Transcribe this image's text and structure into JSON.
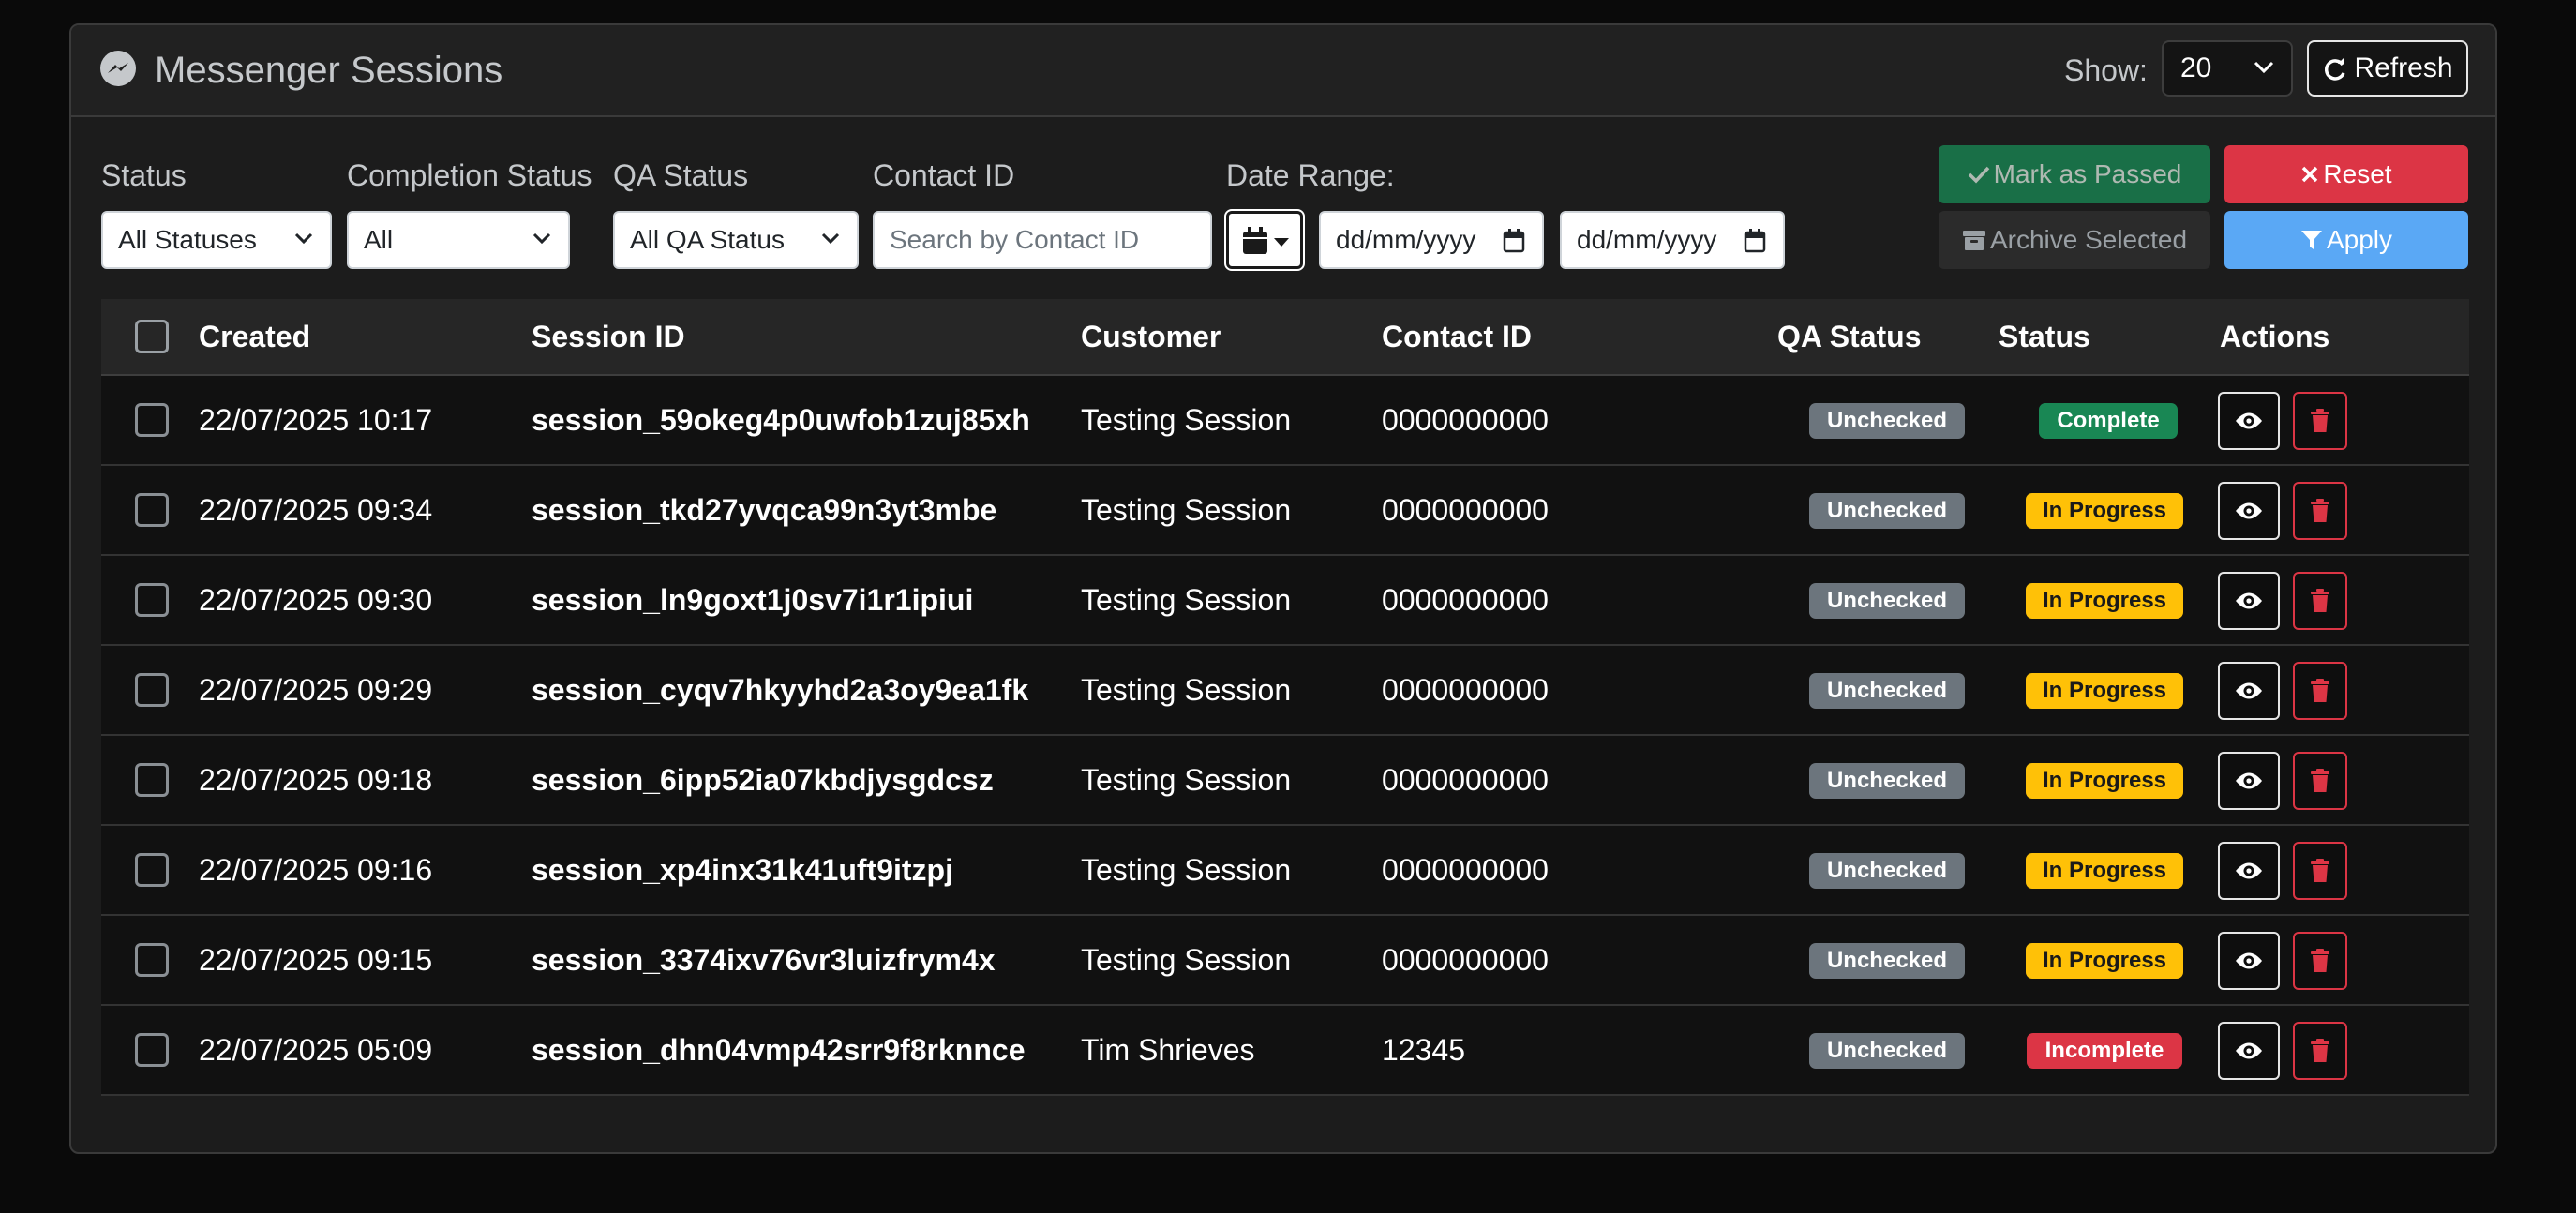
{
  "header": {
    "title": "Messenger Sessions",
    "show_label": "Show:",
    "show_value": "20",
    "refresh_label": "Refresh"
  },
  "filters": {
    "status": {
      "label": "Status",
      "value": "All Statuses"
    },
    "completion": {
      "label": "Completion Status",
      "value": "All"
    },
    "qa": {
      "label": "QA Status",
      "value": "All QA Status"
    },
    "contact": {
      "label": "Contact ID",
      "placeholder": "Search by Contact ID"
    },
    "date_range": {
      "label": "Date Range:",
      "from": "dd/mm/yyyy",
      "to": "dd/mm/yyyy"
    }
  },
  "actions": {
    "mark_passed": "Mark as Passed",
    "reset": "Reset",
    "archive": "Archive Selected",
    "apply": "Apply"
  },
  "table": {
    "columns": [
      "Created",
      "Session ID",
      "Customer",
      "Contact ID",
      "QA Status",
      "Status",
      "Actions"
    ],
    "rows": [
      {
        "created": "22/07/2025 10:17",
        "session": "session_59okeg4p0uwfob1zuj85xh",
        "customer": "Testing Session",
        "contact": "0000000000",
        "qa": "Unchecked",
        "status": "Complete"
      },
      {
        "created": "22/07/2025 09:34",
        "session": "session_tkd27yvqca99n3yt3mbe",
        "customer": "Testing Session",
        "contact": "0000000000",
        "qa": "Unchecked",
        "status": "In Progress"
      },
      {
        "created": "22/07/2025 09:30",
        "session": "session_ln9goxt1j0sv7i1r1ipiui",
        "customer": "Testing Session",
        "contact": "0000000000",
        "qa": "Unchecked",
        "status": "In Progress"
      },
      {
        "created": "22/07/2025 09:29",
        "session": "session_cyqv7hkyyhd2a3oy9ea1fk",
        "customer": "Testing Session",
        "contact": "0000000000",
        "qa": "Unchecked",
        "status": "In Progress"
      },
      {
        "created": "22/07/2025 09:18",
        "session": "session_6ipp52ia07kbdjysgdcsz",
        "customer": "Testing Session",
        "contact": "0000000000",
        "qa": "Unchecked",
        "status": "In Progress"
      },
      {
        "created": "22/07/2025 09:16",
        "session": "session_xp4inx31k41uft9itzpj",
        "customer": "Testing Session",
        "contact": "0000000000",
        "qa": "Unchecked",
        "status": "In Progress"
      },
      {
        "created": "22/07/2025 09:15",
        "session": "session_3374ixv76vr3luizfrym4x",
        "customer": "Testing Session",
        "contact": "0000000000",
        "qa": "Unchecked",
        "status": "In Progress"
      },
      {
        "created": "22/07/2025 05:09",
        "session": "session_dhn04vmp42srr9f8rknnce",
        "customer": "Tim Shrieves",
        "contact": "12345",
        "qa": "Unchecked",
        "status": "Incomplete"
      }
    ]
  },
  "status_colors": {
    "Complete": "#198754",
    "In Progress": "#ffc107",
    "Incomplete": "#dc3545"
  }
}
